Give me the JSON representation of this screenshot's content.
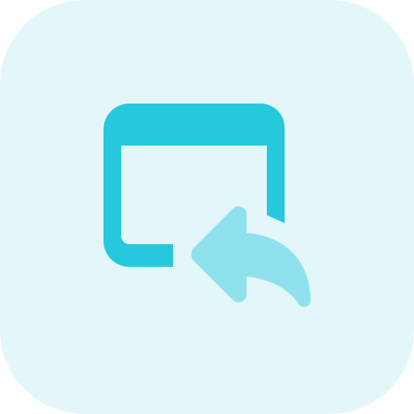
{
  "icon": {
    "name": "browser-window-back-arrow-icon",
    "colors": {
      "background": "#E3F7FA",
      "window": "#26C9DC",
      "arrow": "#8FE2ED"
    }
  }
}
